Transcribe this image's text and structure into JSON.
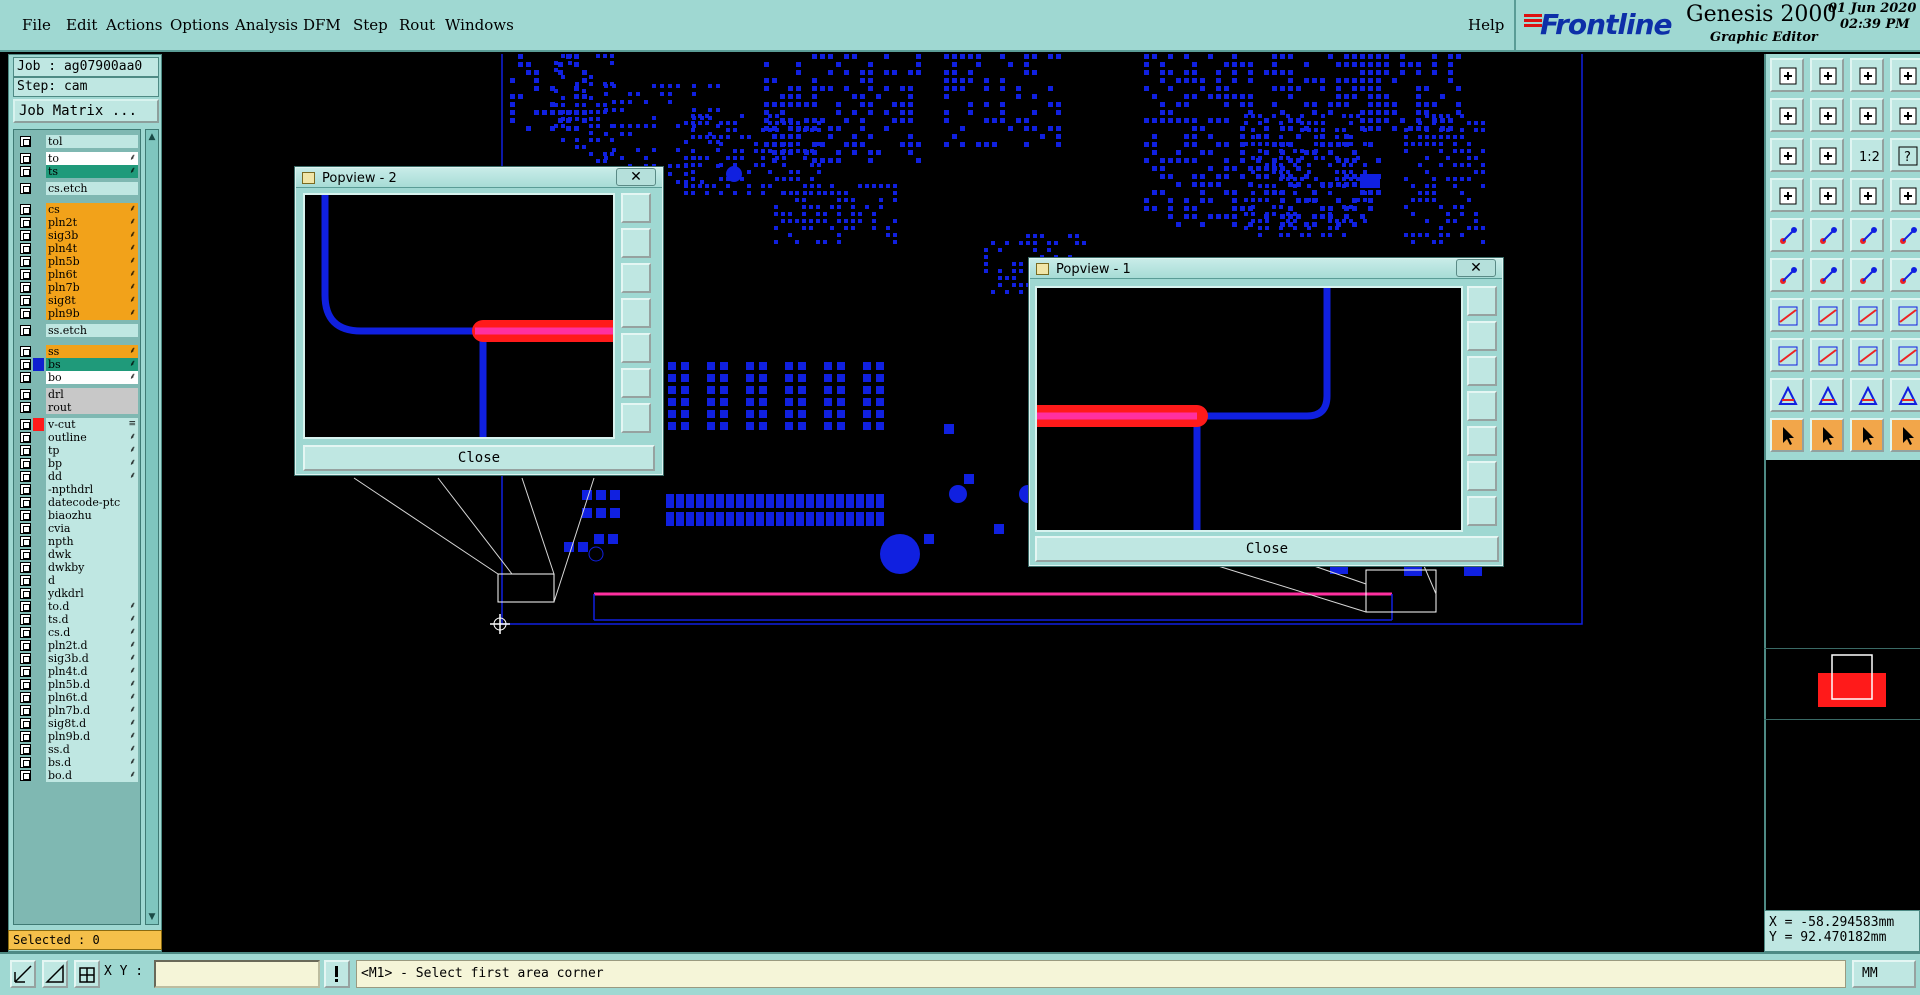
{
  "menu": {
    "items": [
      "File",
      "Edit",
      "Actions",
      "Options",
      "Analysis",
      "DFM",
      "Step",
      "Rout",
      "Windows"
    ],
    "help": "Help"
  },
  "brand": {
    "logo": "Frontline",
    "product": "Genesis 2000",
    "subtitle": "Graphic Editor",
    "date": "01 Jun 2020",
    "time": "02:39 PM"
  },
  "job": {
    "job_label": "Job : ag07900aa0",
    "step_label": "Step: cam",
    "matrix_button": "Job Matrix ..."
  },
  "layers": [
    {
      "name": "tol",
      "kind": "plain",
      "bg": "#bfe7e2"
    },
    {
      "name": "to",
      "kind": "layer",
      "bg": "#ffffff",
      "flag": "⸙"
    },
    {
      "name": "ts",
      "kind": "layer",
      "bg": "#1f9a7a",
      "flag": "⸙"
    },
    {
      "name": "cs.etch",
      "kind": "sep",
      "bg": "#bfe7e2"
    },
    {
      "name": "cs",
      "kind": "layer",
      "bg": "#f2a21a",
      "flag": "⸙"
    },
    {
      "name": "pln2t",
      "kind": "layer",
      "bg": "#f2a21a",
      "flag": "⸙"
    },
    {
      "name": "sig3b",
      "kind": "layer",
      "bg": "#f2a21a",
      "flag": "⸙"
    },
    {
      "name": "pln4t",
      "kind": "layer",
      "bg": "#f2a21a",
      "flag": "⸙"
    },
    {
      "name": "pln5b",
      "kind": "layer",
      "bg": "#f2a21a",
      "flag": "⸙"
    },
    {
      "name": "pln6t",
      "kind": "layer",
      "bg": "#f2a21a",
      "flag": "⸙"
    },
    {
      "name": "pln7b",
      "kind": "layer",
      "bg": "#f2a21a",
      "flag": "⸙"
    },
    {
      "name": "sig8t",
      "kind": "layer",
      "bg": "#f2a21a",
      "flag": "⸙"
    },
    {
      "name": "pln9b",
      "kind": "layer",
      "bg": "#f2a21a",
      "flag": "⸙"
    },
    {
      "name": "ss.etch",
      "kind": "sep",
      "bg": "#bfe7e2"
    },
    {
      "name": "ss",
      "kind": "layer",
      "bg": "#f2a21a",
      "flag": "⸙"
    },
    {
      "name": "bs",
      "kind": "layer",
      "bg": "#1f9a7a",
      "swatch": "#1020d0",
      "flag": "⸙"
    },
    {
      "name": "bo",
      "kind": "layer",
      "bg": "#ffffff",
      "flag": "⸙"
    },
    {
      "name": "drl",
      "kind": "layer",
      "bg": "#c8c8c8"
    },
    {
      "name": "rout",
      "kind": "layer",
      "bg": "#c8c8c8"
    },
    {
      "name": "v-cut",
      "kind": "layer",
      "bg": "#bfe7e2",
      "swatch": "#ff1a1a",
      "flag": "≡"
    },
    {
      "name": "outline",
      "kind": "layer",
      "bg": "#bfe7e2",
      "flag": "⸙"
    },
    {
      "name": "tp",
      "kind": "layer",
      "bg": "#bfe7e2",
      "flag": "⸙"
    },
    {
      "name": "bp",
      "kind": "layer",
      "bg": "#bfe7e2",
      "flag": "⸙"
    },
    {
      "name": "dd",
      "kind": "layer",
      "bg": "#bfe7e2",
      "flag": "⸙"
    },
    {
      "name": "-npthdrl",
      "kind": "layer",
      "bg": "#bfe7e2"
    },
    {
      "name": "datecode-ptc",
      "kind": "layer",
      "bg": "#bfe7e2"
    },
    {
      "name": "biaozhu",
      "kind": "layer",
      "bg": "#bfe7e2"
    },
    {
      "name": "cvia",
      "kind": "layer",
      "bg": "#bfe7e2"
    },
    {
      "name": "npth",
      "kind": "layer",
      "bg": "#bfe7e2"
    },
    {
      "name": "dwk",
      "kind": "layer",
      "bg": "#bfe7e2"
    },
    {
      "name": "dwkby",
      "kind": "layer",
      "bg": "#bfe7e2"
    },
    {
      "name": "d",
      "kind": "layer",
      "bg": "#bfe7e2"
    },
    {
      "name": "ydkdrl",
      "kind": "layer",
      "bg": "#bfe7e2"
    },
    {
      "name": "to.d",
      "kind": "layer",
      "bg": "#bfe7e2",
      "flag": "⸙"
    },
    {
      "name": "ts.d",
      "kind": "layer",
      "bg": "#bfe7e2",
      "flag": "⸙"
    },
    {
      "name": "cs.d",
      "kind": "layer",
      "bg": "#bfe7e2",
      "flag": "⸙"
    },
    {
      "name": "pln2t.d",
      "kind": "layer",
      "bg": "#bfe7e2",
      "flag": "⸙"
    },
    {
      "name": "sig3b.d",
      "kind": "layer",
      "bg": "#bfe7e2",
      "flag": "⸙"
    },
    {
      "name": "pln4t.d",
      "kind": "layer",
      "bg": "#bfe7e2",
      "flag": "⸙"
    },
    {
      "name": "pln5b.d",
      "kind": "layer",
      "bg": "#bfe7e2",
      "flag": "⸙"
    },
    {
      "name": "pln6t.d",
      "kind": "layer",
      "bg": "#bfe7e2",
      "flag": "⸙"
    },
    {
      "name": "pln7b.d",
      "kind": "layer",
      "bg": "#bfe7e2",
      "flag": "⸙"
    },
    {
      "name": "sig8t.d",
      "kind": "layer",
      "bg": "#bfe7e2",
      "flag": "⸙"
    },
    {
      "name": "pln9b.d",
      "kind": "layer",
      "bg": "#bfe7e2",
      "flag": "⸙"
    },
    {
      "name": "ss.d",
      "kind": "layer",
      "bg": "#bfe7e2",
      "flag": "⸙"
    },
    {
      "name": "bs.d",
      "kind": "layer",
      "bg": "#bfe7e2",
      "flag": "⸙"
    },
    {
      "name": "bo.d",
      "kind": "layer",
      "bg": "#bfe7e2",
      "flag": "⸙"
    }
  ],
  "selected": "Selected : 0",
  "popview2": {
    "title": "Popview - 2",
    "close_x": "✕",
    "close_button": "Close"
  },
  "popview1": {
    "title": "Popview - 1",
    "close_x": "✕",
    "close_button": "Close"
  },
  "toolbar": {
    "icons": [
      "layer-up-icon",
      "layer-down-icon",
      "home-icon",
      "window-split-icon",
      "zoom-left-icon",
      "zoom-right-icon",
      "toggle-icon",
      "redraw-icon",
      "zoom-fit-icon",
      "zoom-center-icon",
      "scale-1-2-icon",
      "help-icon",
      "measure-icon",
      "grid-icon",
      "snap-red-icon",
      "snap-blue-icon",
      "pad-icon",
      "line-red-icon",
      "bar-icon",
      "dot-icon",
      "node-icon",
      "cross-icon",
      "arc-icon",
      "arrow-icon",
      "angle-icon",
      "slash-icon",
      "rotate-icon",
      "fringe-icon",
      "point-icon",
      "minus-icon",
      "move-icon",
      "copy-icon",
      "triangle-icon",
      "triangle-a-icon",
      "triangle-b-icon",
      "triangle-c-icon",
      "pointer-icon",
      "pointer-red-icon",
      "pointer-mark-icon",
      "pointer-drag-icon"
    ],
    "scale_label": "1:2",
    "help_label": "?"
  },
  "coords": {
    "x": "X = -58.294583mm",
    "y": "Y = 92.470182mm"
  },
  "bottom": {
    "xy_label": "X Y :",
    "xy_value": "",
    "message": "<M1> - Select first area corner",
    "units": "MM"
  },
  "colors": {
    "panel": "#9fd8d2",
    "trace_blue": "#1020e0",
    "trace_red": "#ff1a1a",
    "trace_magenta": "#ff30a0",
    "brand_blue": "#0d2fa8"
  }
}
